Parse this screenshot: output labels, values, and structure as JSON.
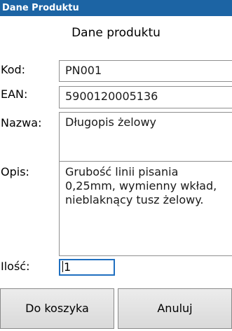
{
  "window": {
    "title": "Dane Produktu"
  },
  "form": {
    "heading": "Dane produktu",
    "code_label": "Kod:",
    "code_value": "PN001",
    "ean_label": "EAN:",
    "ean_value": "5900120005136",
    "name_label": "Nazwa:",
    "name_value": "Długopis żelowy",
    "description_label": "Opis:",
    "description_value": "Grubość linii pisania\n0,25mm, wymienny wkład,\nnieblaknący tusz żelowy.",
    "quantity_label": "Ilość:",
    "quantity_value": "1"
  },
  "buttons": {
    "add_to_cart": "Do koszyka",
    "cancel": "Anuluj"
  },
  "colors": {
    "titlebar": "#1c64a4",
    "focus_border": "#1f6fc0"
  }
}
